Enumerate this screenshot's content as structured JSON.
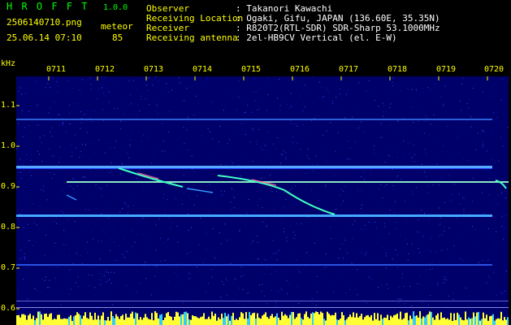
{
  "header": {
    "app_title": "H R O F F T",
    "version": "1.0.0",
    "filename": "2506140710.png",
    "datetime": "25.06.14 07:10",
    "type_label": "meteor",
    "count": "85",
    "fields": [
      {
        "label": "Observer",
        "value": ": Takanori Kawachi"
      },
      {
        "label": "Receiving Location",
        "value": ": Ogaki, Gifu, JAPAN (136.60E, 35.35N)"
      },
      {
        "label": "Receiver",
        "value": ": R820T2(RTL-SDR) SDR-Sharp 53.1000MHz"
      },
      {
        "label": "Receiving antenna",
        "value": ": 2el-HB9CV Vertical (el. E-W)"
      }
    ]
  },
  "y_axis": {
    "unit": "kHz",
    "ticks": [
      {
        "label": "1.1",
        "value": 1.1
      },
      {
        "label": "1.0",
        "value": 1.0
      },
      {
        "label": "0.9",
        "value": 0.9
      },
      {
        "label": "0.8",
        "value": 0.8
      },
      {
        "label": "0.7",
        "value": 0.7
      },
      {
        "label": "0.6",
        "value": 0.6
      }
    ]
  },
  "x_axis": {
    "ticks": [
      "0711",
      "0712",
      "0713",
      "0714",
      "0715",
      "0716",
      "0717",
      "0718",
      "0719",
      "0720"
    ]
  },
  "colors": {
    "text_yellow": "#ffff00",
    "text_white": "#ffffff",
    "text_green": "#00ff00",
    "text_blue": "#8080ff",
    "background_noise": "#00006a",
    "carrier_line": "#3399ff",
    "meteor_trail": "#40ffc0",
    "power_bars": "#ffff33"
  }
}
